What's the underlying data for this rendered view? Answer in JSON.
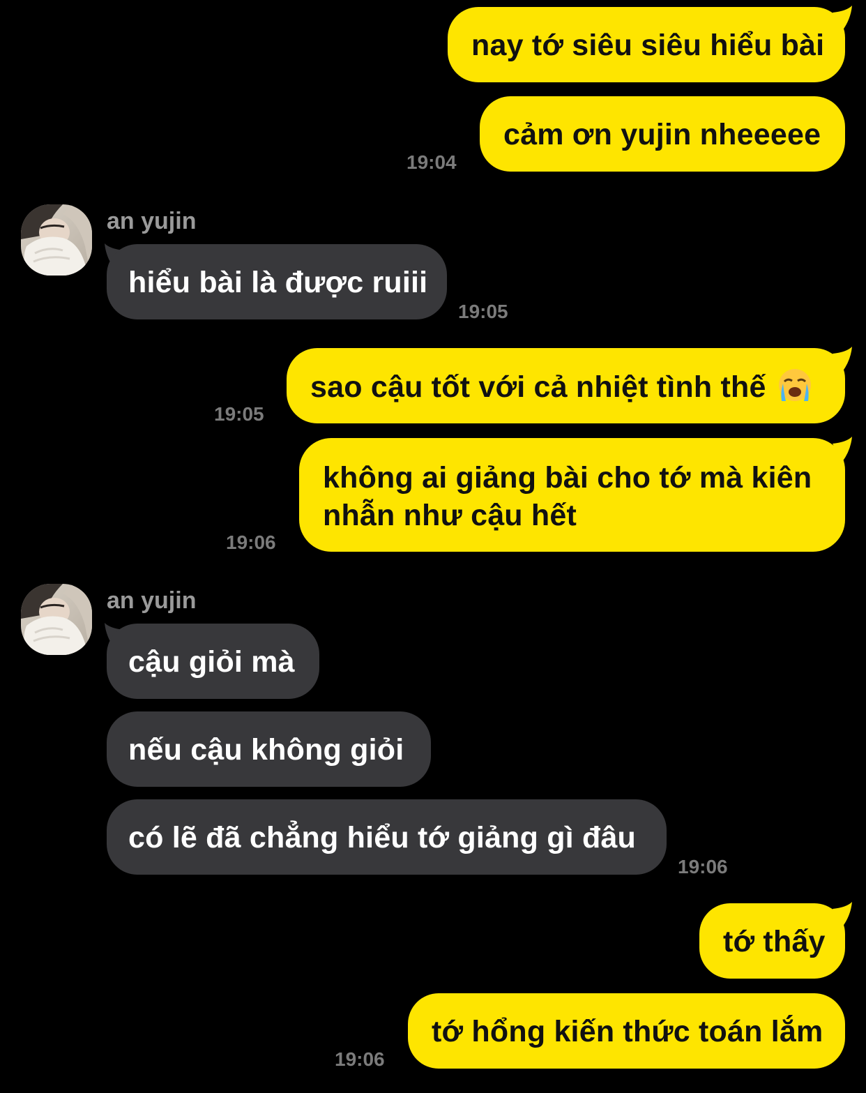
{
  "colors": {
    "background": "#000000",
    "my_bubble": "#FEE500",
    "their_bubble": "#38383B",
    "timestamp": "#7B7B7B",
    "sender_name": "#9A9A9A"
  },
  "messages": [
    {
      "side": "mine",
      "text": "nay tớ siêu siêu hiểu bài"
    },
    {
      "side": "mine",
      "text": "cảm ơn yujin nheeeee",
      "time": "19:04"
    },
    {
      "side": "theirs",
      "sender": "an yujin",
      "avatar": "avatar-photo",
      "text": "hiểu bài là được ruiii",
      "time": "19:05"
    },
    {
      "side": "mine",
      "text": "sao cậu tốt với cả nhiệt tình thế",
      "emoji": "loudly-crying-face-icon",
      "time": "19:05"
    },
    {
      "side": "mine",
      "lines": [
        "không ai giảng bài cho tớ mà kiên",
        "nhẫn như cậu hết"
      ],
      "time": "19:06"
    },
    {
      "side": "theirs",
      "sender": "an yujin",
      "avatar": "avatar-photo",
      "text": "cậu giỏi mà"
    },
    {
      "side": "theirs",
      "text": "nếu cậu không giỏi"
    },
    {
      "side": "theirs",
      "text": "có lẽ đã chẳng hiểu tớ giảng gì đâu",
      "time": "19:06"
    },
    {
      "side": "mine",
      "text": "tớ thấy"
    },
    {
      "side": "mine",
      "text": "tớ hổng kiến thức toán lắm",
      "time": "19:06"
    }
  ]
}
